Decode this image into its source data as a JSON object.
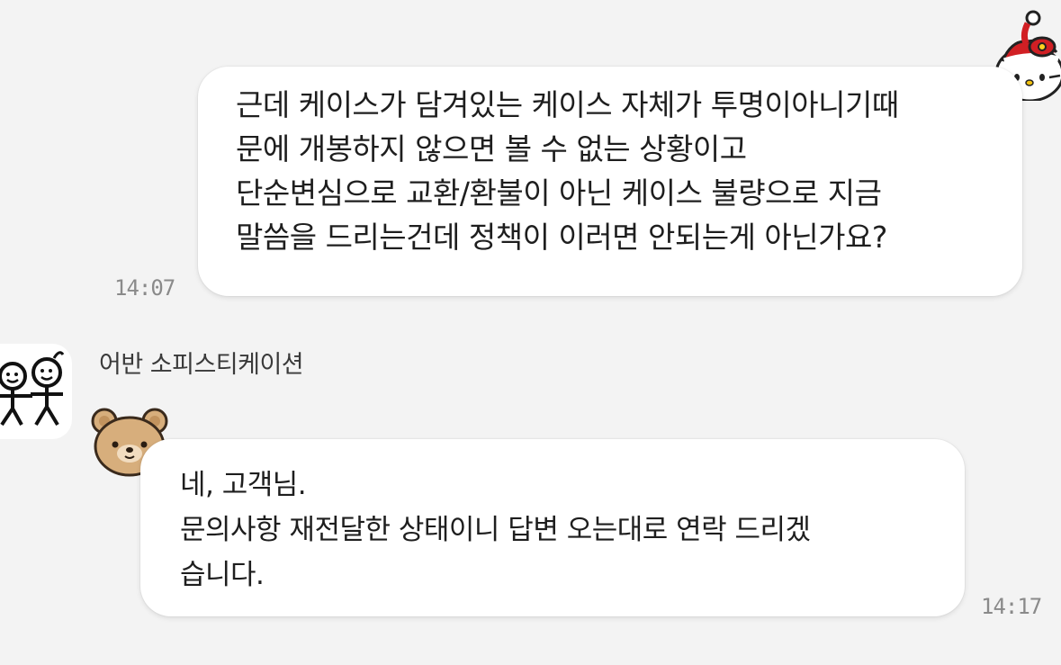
{
  "outgoing_message": {
    "lines": [
      "근데 케이스가 담겨있는 케이스 자체가 투명이아니기때",
      "문에 개봉하지 않으면 볼 수 없는 상황이고",
      "단순변심으로 교환/환불이 아닌 케이스 불량으로  지금",
      "말씀을 드리는건데 정책이 이러면 안되는게 아닌가요?"
    ],
    "time": "14:07"
  },
  "incoming_message": {
    "sender": "어반 소피스티케이션",
    "lines": [
      "네, 고객님.",
      "문의사항 재전달한 상태이니 답변 오는대로 연락 드리겠",
      "습니다."
    ],
    "time": "14:17"
  },
  "icons": {
    "sender_avatar": "stick-figures-logo-icon",
    "my_avatar": "hello-kitty-santa-icon",
    "sender_sticker": "bear-face-icon"
  },
  "colors": {
    "background": "#f3f3f3",
    "bubble": "#ffffff",
    "text": "#1e1e1e",
    "time": "#8a8a8a"
  }
}
